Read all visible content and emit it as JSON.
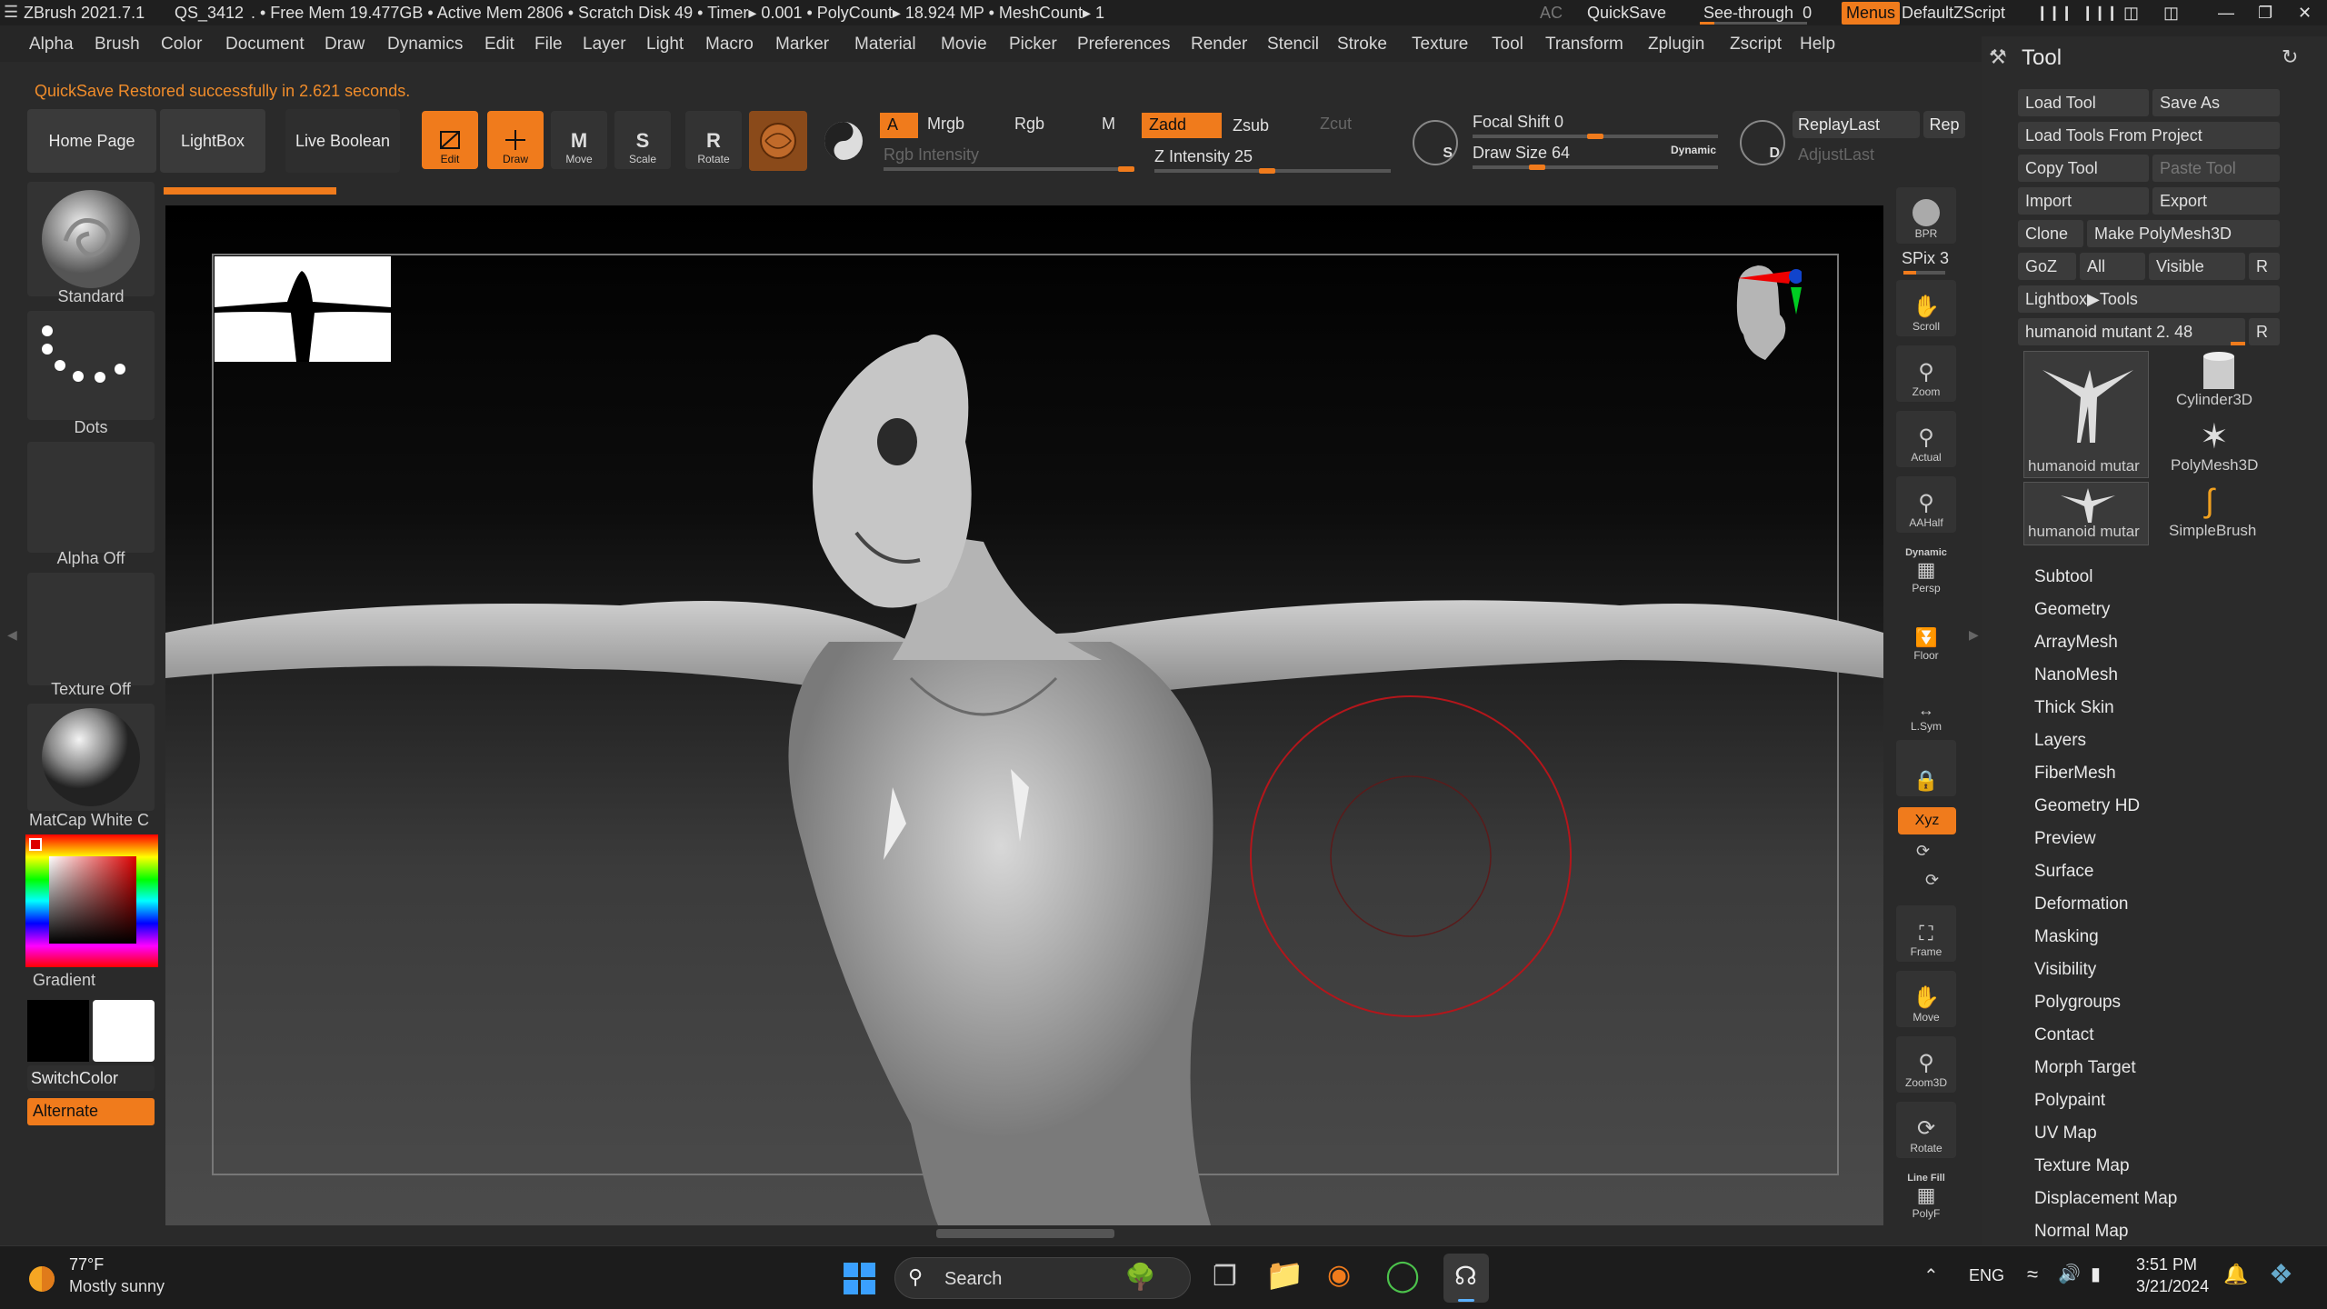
{
  "titlebar": {
    "app": "ZBrush 2021.7.1",
    "qs": "QS_3412",
    "stats": ". • Free Mem 19.477GB • Active Mem 2806 • Scratch Disk 49 • Timer▸ 0.001 • PolyCount▸ 18.924 MP • MeshCount▸ 1",
    "ac": "AC",
    "quicksave": "QuickSave",
    "seethrough": "See-through",
    "seethrough_value": "0",
    "menus": "Menus",
    "script": "DefaultZScript"
  },
  "menubar": {
    "items": [
      "Alpha",
      "Brush",
      "Color",
      "Document",
      "Draw",
      "Dynamics",
      "Edit",
      "File",
      "Layer",
      "Light",
      "Macro",
      "Marker",
      "Material",
      "Movie",
      "Picker",
      "Preferences",
      "Render",
      "Stencil",
      "Stroke",
      "Texture",
      "Tool",
      "Transform",
      "Zplugin",
      "Zscript",
      "Help"
    ]
  },
  "notice": "QuickSave Restored successfully in 2.621 seconds.",
  "toolbar": {
    "home_page": "Home Page",
    "lightbox": "LightBox",
    "live_boolean": "Live Boolean",
    "edit": "Edit",
    "draw": "Draw",
    "move": "Move",
    "scale": "Scale",
    "rotate": "Rotate",
    "a": "A",
    "mrgb": "Mrgb",
    "rgb": "Rgb",
    "m": "M",
    "zadd": "Zadd",
    "zsub": "Zsub",
    "zcut": "Zcut",
    "rgb_intensity": "Rgb Intensity",
    "z_intensity": "Z Intensity 25",
    "z_intensity_fraction": 0.25,
    "s": "S",
    "focal_shift": "Focal Shift 0",
    "draw_size": "Draw Size 64",
    "draw_size_fraction": 0.064,
    "dynamic": "Dynamic",
    "d": "D",
    "replay_last": "ReplayLast",
    "rep": "Rep",
    "adjust_last": "AdjustLast"
  },
  "leftshelf": {
    "brush": "Standard",
    "stroke": "Dots",
    "alpha": "Alpha Off",
    "texture": "Texture Off",
    "material": "MatCap White C",
    "gradient": "Gradient",
    "switchcolor": "SwitchColor",
    "alternate": "Alternate"
  },
  "rightbar": {
    "bpr": "BPR",
    "spix": "SPix 3",
    "scroll": "Scroll",
    "zoom": "Zoom",
    "actual": "Actual",
    "aahalf": "AAHalf",
    "dynamic": "Dynamic",
    "persp": "Persp",
    "floor": "Floor",
    "lsym": "L.Sym",
    "xyz": "Xyz",
    "frame": "Frame",
    "move": "Move",
    "zoom3d": "Zoom3D",
    "rotate": "Rotate",
    "linefill": "Line Fill",
    "polyf": "PolyF"
  },
  "palette": {
    "title": "Tool",
    "load_tool": "Load Tool",
    "save_as": "Save As",
    "load_tools_from_project": "Load Tools From Project",
    "copy_tool": "Copy Tool",
    "paste_tool": "Paste Tool",
    "import": "Import",
    "export": "Export",
    "clone": "Clone",
    "make_polymesh": "Make PolyMesh3D",
    "goz": "GoZ",
    "all": "All",
    "visible": "Visible",
    "r": "R",
    "lightbox_tools": "Lightbox▶Tools",
    "current_tool": "humanoid mutant 2. 48",
    "thumbs": [
      "humanoid mutar",
      "Cylinder3D",
      "PolyMesh3D",
      "humanoid mutar",
      "SimpleBrush"
    ],
    "sections": [
      "Subtool",
      "Geometry",
      "ArrayMesh",
      "NanoMesh",
      "Thick Skin",
      "Layers",
      "FiberMesh",
      "Geometry HD",
      "Preview",
      "Surface",
      "Deformation",
      "Masking",
      "Visibility",
      "Polygroups",
      "Contact",
      "Morph Target",
      "Polypaint",
      "UV Map",
      "Texture Map",
      "Displacement Map",
      "Normal Map"
    ]
  },
  "taskbar": {
    "temp": "77°F",
    "weather": "Mostly sunny",
    "search": "Search",
    "lang": "ENG",
    "time": "3:51 PM",
    "date": "3/21/2024"
  }
}
